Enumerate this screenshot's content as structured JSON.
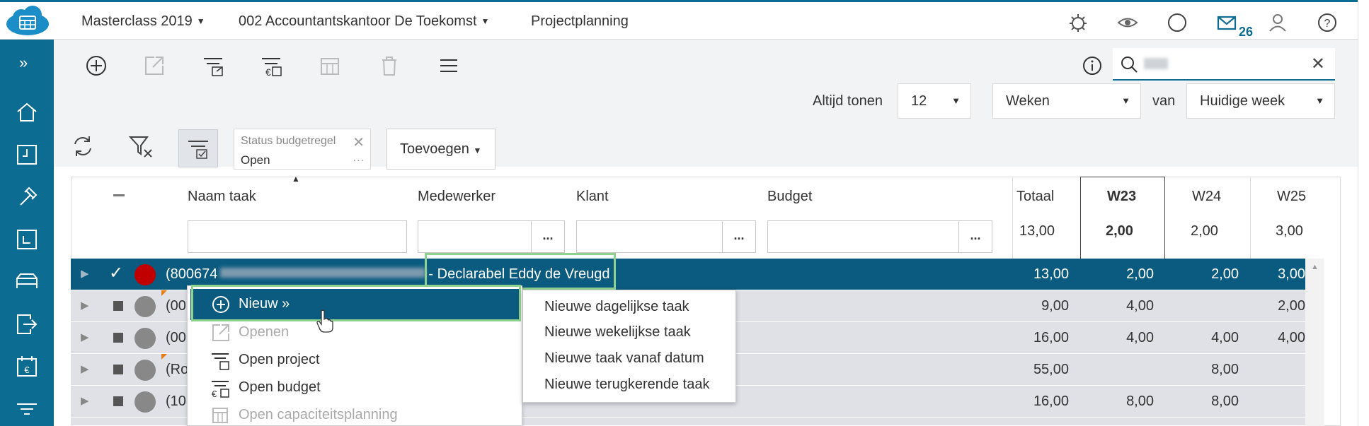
{
  "topbar": {
    "environment": "Masterclass 2019",
    "company": "002 Accountantskantoor De Toekomst",
    "module": "Projectplanning",
    "mail_count": "26",
    "icons": [
      "bug-icon",
      "eye-icon",
      "circle-icon",
      "mail-icon",
      "user-icon",
      "help-icon"
    ]
  },
  "sidebar": {
    "items": [
      "expand-icon",
      "home-icon",
      "clock-icon",
      "hammer-icon",
      "document-clock-icon",
      "bed-icon",
      "export-icon",
      "calendar-euro-icon",
      "filter-lines-icon"
    ]
  },
  "toolbar": {
    "search_placeholder": "",
    "always_show_label": "Altijd tonen",
    "always_show_value": "12",
    "period_value": "Weken",
    "from_label": "van",
    "from_value": "Huidige week"
  },
  "filters": {
    "chip_title": "Status budgetregel",
    "chip_value": "Open",
    "chip_dots": "...",
    "add_button": "Toevoegen"
  },
  "grid": {
    "columns": {
      "name": "Naam taak",
      "employee": "Medewerker",
      "client": "Klant",
      "budget": "Budget",
      "total": "Totaal",
      "w23": "W23",
      "w24": "W24",
      "w25": "W25"
    },
    "column_totals": {
      "total": "13,00",
      "w23": "2,00",
      "w24": "2,00",
      "w25": "3,00"
    },
    "filter_dots": "...",
    "rows": [
      {
        "prefix": "(800674",
        "suffix": "- Declarabel Eddy de Vreugd",
        "total": "13,00",
        "w23": "2,00",
        "w24": "2,00",
        "w25": "3,00",
        "selected": true
      },
      {
        "prefix": "(00",
        "suffix": "",
        "total": "9,00",
        "w23": "4,00",
        "w24": "",
        "w25": "2,00"
      },
      {
        "prefix": "(00",
        "suffix": "",
        "total": "16,00",
        "w23": "4,00",
        "w24": "4,00",
        "w25": "4,00"
      },
      {
        "prefix": "(Ro",
        "suffix": "",
        "total": "55,00",
        "w23": "",
        "w24": "8,00",
        "w25": ""
      },
      {
        "prefix": "(10",
        "suffix": "",
        "total": "16,00",
        "w23": "8,00",
        "w24": "8,00",
        "w25": ""
      }
    ]
  },
  "context_menu": {
    "items": [
      {
        "label": "Nieuw »",
        "icon": "plus-circle-icon",
        "state": "active"
      },
      {
        "label": "Openen",
        "icon": "open-external-icon",
        "state": "disabled"
      },
      {
        "label": "Open project",
        "icon": "open-project-icon",
        "state": "enabled"
      },
      {
        "label": "Open budget",
        "icon": "open-budget-icon",
        "state": "enabled"
      },
      {
        "label": "Open capaciteitsplanning",
        "icon": "calendar-grid-icon",
        "state": "disabled"
      }
    ],
    "submenu": [
      "Nieuwe dagelijkse taak",
      "Nieuwe wekelijkse taak",
      "Nieuwe taak vanaf datum",
      "Nieuwe terugkerende taak"
    ]
  },
  "colors": {
    "brand": "#0d6c91",
    "selected_row": "#0a5b7f",
    "status_red": "#c00000",
    "highlight_green": "#8fd18f"
  }
}
